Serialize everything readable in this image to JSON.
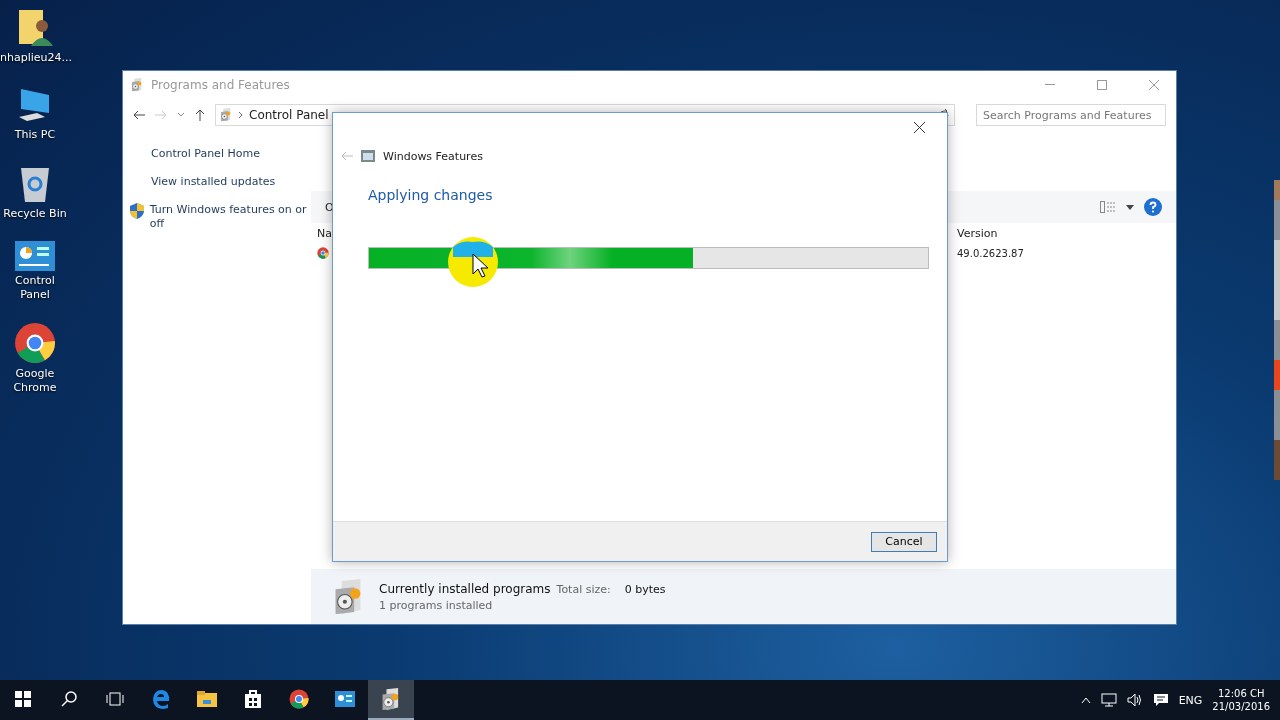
{
  "desktop": {
    "icons": [
      {
        "kind": "user-folder",
        "label": "nhaplieu24..."
      },
      {
        "kind": "computer",
        "label": "This PC"
      },
      {
        "kind": "bin",
        "label": "Recycle Bin"
      },
      {
        "kind": "control",
        "label": "Control Panel"
      },
      {
        "kind": "chrome",
        "label": "Google Chrome"
      }
    ]
  },
  "window": {
    "title": "Programs and Features",
    "breadcrumb": [
      "Control Panel"
    ],
    "search": {
      "placeholder": "Search Programs and Features"
    },
    "sidebar": {
      "home": "Control Panel Home",
      "links": [
        {
          "label": "View installed updates",
          "shield": false
        },
        {
          "label": "Turn Windows features on or off",
          "shield": true
        }
      ]
    },
    "toolbar_fragment": "O",
    "columns": [
      "Na",
      "Version"
    ],
    "rows": [
      {
        "version": "49.0.2623.87"
      }
    ],
    "status": {
      "title": "Currently installed programs",
      "size_label": "Total size:",
      "size": "0 bytes",
      "count": "1 programs installed"
    }
  },
  "dialog": {
    "title": "Windows Features",
    "heading": "Applying changes",
    "progress": {
      "level": 0.58
    },
    "button": "Cancel"
  },
  "taskbar": {
    "apps": [
      {
        "kind": "edge",
        "active": false
      },
      {
        "kind": "explorer",
        "active": false
      },
      {
        "kind": "store",
        "active": false
      },
      {
        "kind": "chrome",
        "active": false
      },
      {
        "kind": "control",
        "active": false
      },
      {
        "kind": "programs",
        "active": true
      }
    ],
    "language": "ENG",
    "time": "12:06 CH",
    "date": "21/03/2016"
  }
}
